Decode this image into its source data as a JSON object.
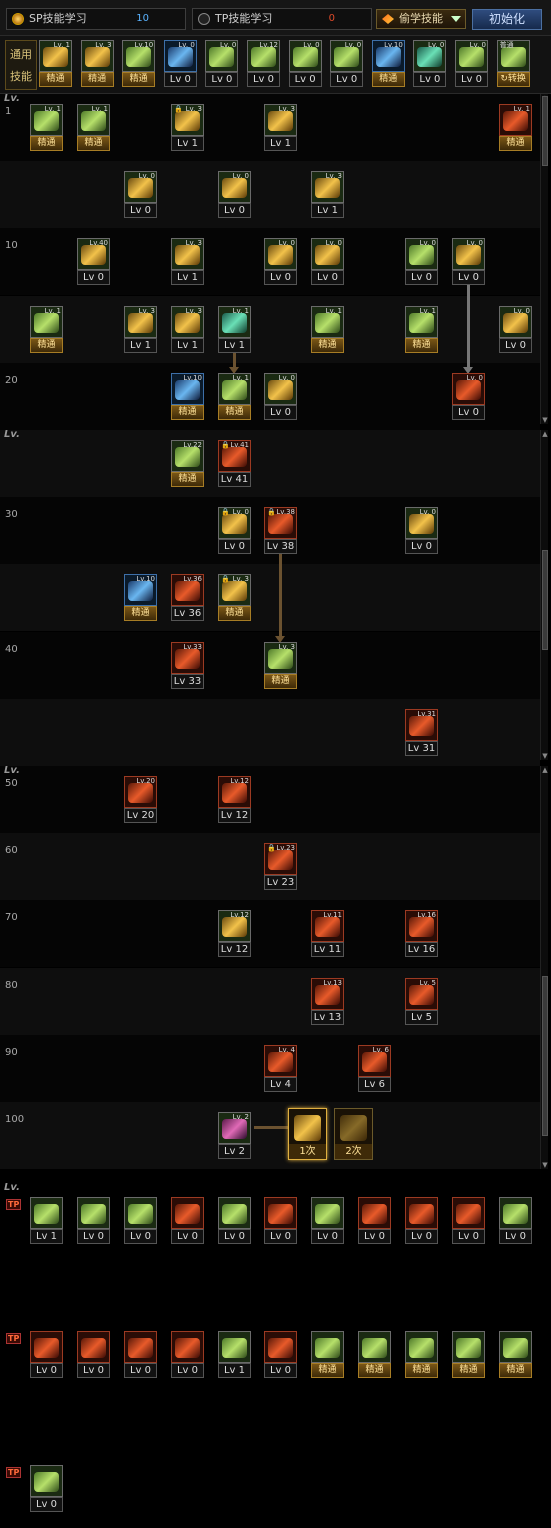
{
  "tabs": {
    "sp": {
      "label": "SP技能学习",
      "points": "10"
    },
    "tp": {
      "label": "TP技能学习",
      "points": "0"
    },
    "steal": "偷学技能",
    "reset": "初始化"
  },
  "common": {
    "label": "通用技能",
    "skills": [
      {
        "lv": "Lv. 1",
        "label": "精通",
        "kind": "master",
        "color": "gold"
      },
      {
        "lv": "Lv. 3",
        "label": "精通",
        "kind": "master",
        "color": "gold"
      },
      {
        "lv": "Lv.10",
        "label": "精通",
        "kind": "master",
        "color": "green"
      },
      {
        "lv": "Lv. 0",
        "label": "Lv 0",
        "kind": "lv",
        "color": "blue"
      },
      {
        "lv": "Lv. 0",
        "label": "Lv 0",
        "kind": "lv",
        "color": "green"
      },
      {
        "lv": "Lv.12",
        "label": "Lv 0",
        "kind": "lv",
        "color": "green"
      },
      {
        "lv": "Lv. 0",
        "label": "Lv 0",
        "kind": "lv",
        "color": "green"
      },
      {
        "lv": "Lv. 0",
        "label": "Lv 0",
        "kind": "lv",
        "color": "green"
      },
      {
        "lv": "Lv.10",
        "label": "精通",
        "kind": "master",
        "color": "blue"
      },
      {
        "lv": "Lv. 0",
        "label": "Lv 0",
        "kind": "lv",
        "color": "teal"
      },
      {
        "lv": "Lv. 0",
        "label": "Lv 0",
        "kind": "lv",
        "color": "green"
      },
      {
        "lv": "",
        "label": "↻转换",
        "kind": "master",
        "color": "green",
        "badge": "普通"
      }
    ]
  },
  "sections": {
    "lv_header": "Lv.",
    "levels": [
      "1",
      "10",
      "20",
      "30",
      "40",
      "50",
      "60",
      "70",
      "80",
      "90",
      "100"
    ]
  },
  "tree": [
    {
      "row": 0,
      "col": 0,
      "lv": "Lv. 1",
      "label": "精通",
      "kind": "master",
      "color": "green"
    },
    {
      "row": 0,
      "col": 1,
      "lv": "Lv. 1",
      "label": "精通",
      "kind": "master",
      "color": "green"
    },
    {
      "row": 0,
      "col": 3,
      "lv": "Lv. 3",
      "label": "Lv 1",
      "kind": "lv",
      "color": "gold",
      "lock": true
    },
    {
      "row": 0,
      "col": 5,
      "lv": "Lv. 3",
      "label": "Lv 1",
      "kind": "lv",
      "color": "gold"
    },
    {
      "row": 0,
      "col": 10,
      "lv": "Lv. 1",
      "label": "精通",
      "kind": "master",
      "color": "red"
    },
    {
      "row": 1,
      "col": 2,
      "lv": "Lv. 0",
      "label": "Lv 0",
      "kind": "lv",
      "color": "gold"
    },
    {
      "row": 1,
      "col": 4,
      "lv": "Lv. 0",
      "label": "Lv 0",
      "kind": "lv",
      "color": "gold"
    },
    {
      "row": 1,
      "col": 6,
      "lv": "Lv. 3",
      "label": "Lv 1",
      "kind": "lv",
      "color": "gold"
    },
    {
      "row": 2,
      "col": 1,
      "lv": "Lv.40",
      "label": "Lv 0",
      "kind": "lv",
      "color": "gold"
    },
    {
      "row": 2,
      "col": 3,
      "lv": "Lv. 3",
      "label": "Lv 1",
      "kind": "lv",
      "color": "gold"
    },
    {
      "row": 2,
      "col": 5,
      "lv": "Lv. 0",
      "label": "Lv 0",
      "kind": "lv",
      "color": "gold"
    },
    {
      "row": 2,
      "col": 6,
      "lv": "Lv. 0",
      "label": "Lv 0",
      "kind": "lv",
      "color": "gold"
    },
    {
      "row": 2,
      "col": 8,
      "lv": "Lv. 0",
      "label": "Lv 0",
      "kind": "lv",
      "color": "green"
    },
    {
      "row": 2,
      "col": 9,
      "lv": "Lv. 0",
      "label": "Lv 0",
      "kind": "lv",
      "color": "gold"
    },
    {
      "row": 3,
      "col": 0,
      "lv": "Lv. 1",
      "label": "精通",
      "kind": "master",
      "color": "green"
    },
    {
      "row": 3,
      "col": 2,
      "lv": "Lv. 3",
      "label": "Lv 1",
      "kind": "lv",
      "color": "gold"
    },
    {
      "row": 3,
      "col": 3,
      "lv": "Lv. 3",
      "label": "Lv 1",
      "kind": "lv",
      "color": "gold"
    },
    {
      "row": 3,
      "col": 4,
      "lv": "Lv. 1",
      "label": "Lv 1",
      "kind": "lv",
      "color": "teal"
    },
    {
      "row": 3,
      "col": 6,
      "lv": "Lv. 1",
      "label": "精通",
      "kind": "master",
      "color": "green"
    },
    {
      "row": 3,
      "col": 8,
      "lv": "Lv. 1",
      "label": "精通",
      "kind": "master",
      "color": "green"
    },
    {
      "row": 3,
      "col": 10,
      "lv": "Lv. 0",
      "label": "Lv 0",
      "kind": "lv",
      "color": "gold"
    },
    {
      "row": 4,
      "col": 3,
      "lv": "Lv.10",
      "label": "精通",
      "kind": "master",
      "color": "blue",
      "gold": true
    },
    {
      "row": 4,
      "col": 4,
      "lv": "Lv. 1",
      "label": "精通",
      "kind": "master",
      "color": "green"
    },
    {
      "row": 4,
      "col": 5,
      "lv": "Lv. 0",
      "label": "Lv 0",
      "kind": "lv",
      "color": "gold"
    },
    {
      "row": 4,
      "col": 9,
      "lv": "Lv. 0",
      "label": "Lv 0",
      "kind": "lv",
      "color": "red"
    },
    {
      "row": 5,
      "col": 3,
      "lv": "Lv.22",
      "label": "精通",
      "kind": "master",
      "color": "green"
    },
    {
      "row": 5,
      "col": 4,
      "lv": "Lv.41",
      "label": "Lv 41",
      "kind": "lv",
      "color": "red",
      "lock": true
    },
    {
      "row": 6,
      "col": 4,
      "lv": "Lv. 0",
      "label": "Lv 0",
      "kind": "lv",
      "color": "gold",
      "lock": true
    },
    {
      "row": 6,
      "col": 5,
      "lv": "Lv.38",
      "label": "Lv 38",
      "kind": "lv",
      "color": "red",
      "lock": true
    },
    {
      "row": 6,
      "col": 8,
      "lv": "Lv. 0",
      "label": "Lv 0",
      "kind": "lv",
      "color": "gold"
    },
    {
      "row": 7,
      "col": 2,
      "lv": "Lv.10",
      "label": "精通",
      "kind": "master",
      "color": "blue",
      "gold": true
    },
    {
      "row": 7,
      "col": 3,
      "lv": "Lv.36",
      "label": "Lv 36",
      "kind": "lv",
      "color": "red"
    },
    {
      "row": 7,
      "col": 4,
      "lv": "Lv. 3",
      "label": "精通",
      "kind": "master",
      "color": "gold",
      "lock": true
    },
    {
      "row": 8,
      "col": 3,
      "lv": "Lv.33",
      "label": "Lv 33",
      "kind": "lv",
      "color": "red"
    },
    {
      "row": 8,
      "col": 5,
      "lv": "Lv. 3",
      "label": "精通",
      "kind": "master",
      "color": "green"
    },
    {
      "row": 9,
      "col": 8,
      "lv": "Lv.31",
      "label": "Lv 31",
      "kind": "lv",
      "color": "red"
    },
    {
      "row": 10,
      "col": 2,
      "lv": "Lv.20",
      "label": "Lv 20",
      "kind": "lv",
      "color": "red"
    },
    {
      "row": 10,
      "col": 4,
      "lv": "Lv.12",
      "label": "Lv 12",
      "kind": "lv",
      "color": "red"
    },
    {
      "row": 11,
      "col": 5,
      "lv": "Lv.23",
      "label": "Lv 23",
      "kind": "lv",
      "color": "red",
      "lock": true
    },
    {
      "row": 12,
      "col": 4,
      "lv": "Lv.12",
      "label": "Lv 12",
      "kind": "lv",
      "color": "gold"
    },
    {
      "row": 12,
      "col": 6,
      "lv": "Lv.11",
      "label": "Lv 11",
      "kind": "lv",
      "color": "red"
    },
    {
      "row": 12,
      "col": 8,
      "lv": "Lv.16",
      "label": "Lv 16",
      "kind": "lv",
      "color": "red"
    },
    {
      "row": 13,
      "col": 6,
      "lv": "Lv.13",
      "label": "Lv 13",
      "kind": "lv",
      "color": "red"
    },
    {
      "row": 13,
      "col": 8,
      "lv": "Lv. 5",
      "label": "Lv 5",
      "kind": "lv",
      "color": "red"
    },
    {
      "row": 14,
      "col": 5,
      "lv": "Lv. 4",
      "label": "Lv 4",
      "kind": "lv",
      "color": "red"
    },
    {
      "row": 14,
      "col": 7,
      "lv": "Lv. 6",
      "label": "Lv 6",
      "kind": "lv",
      "color": "red"
    },
    {
      "row": 15,
      "col": 4,
      "lv": "Lv. 2",
      "label": "Lv 2",
      "kind": "lv",
      "color": "purple"
    }
  ],
  "awakening": [
    {
      "label": "1次",
      "selected": true
    },
    {
      "label": "2次",
      "selected": false
    }
  ],
  "tp": {
    "mark": "TP",
    "row1": [
      {
        "label": "Lv 1",
        "color": "green"
      },
      {
        "label": "Lv 0",
        "color": "green"
      },
      {
        "label": "Lv 0",
        "color": "green"
      },
      {
        "label": "Lv 0",
        "color": "red"
      },
      {
        "label": "Lv 0",
        "color": "green"
      },
      {
        "label": "Lv 0",
        "color": "red"
      },
      {
        "label": "Lv 0",
        "color": "green"
      },
      {
        "label": "Lv 0",
        "color": "red"
      },
      {
        "label": "Lv 0",
        "color": "red"
      },
      {
        "label": "Lv 0",
        "color": "red"
      },
      {
        "label": "Lv 0",
        "color": "green"
      }
    ],
    "row2": [
      {
        "label": "Lv 0",
        "color": "red"
      },
      {
        "label": "Lv 0",
        "color": "red"
      },
      {
        "label": "Lv 0",
        "color": "red"
      },
      {
        "label": "Lv 0",
        "color": "red"
      },
      {
        "label": "Lv 1",
        "color": "green"
      },
      {
        "label": "Lv 0",
        "color": "red"
      },
      {
        "label": "精通",
        "color": "green"
      },
      {
        "label": "精通",
        "color": "green"
      },
      {
        "label": "精通",
        "color": "green"
      },
      {
        "label": "精通",
        "color": "green"
      },
      {
        "label": "精通",
        "color": "green"
      }
    ],
    "row3": [
      {
        "label": "Lv 0",
        "color": "green"
      }
    ]
  }
}
